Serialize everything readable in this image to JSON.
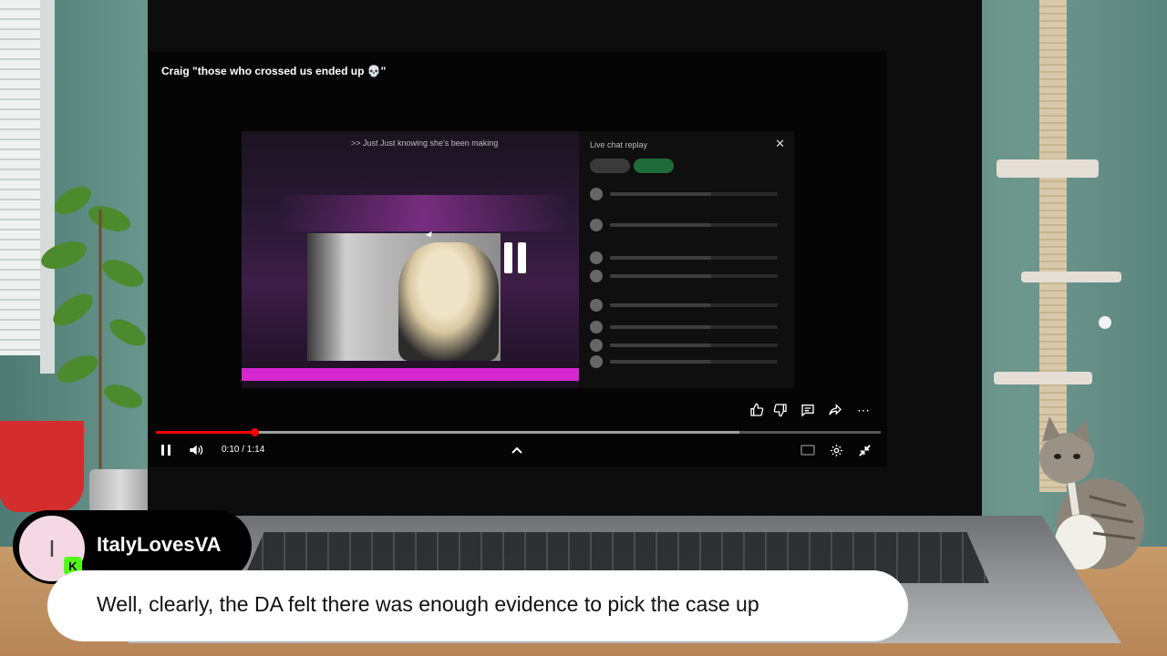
{
  "video": {
    "title": "Craig \"those who crossed us ended up 💀\"",
    "time_display": "0:10 / 1:14",
    "progress_fraction": 0.136,
    "buffered_fraction": 0.805,
    "inner_stream_caption": ">> Just Just knowing she's been making",
    "chat_header_label": "Live chat replay"
  },
  "actions": {
    "like_icon": "thumbs-up-icon",
    "dislike_icon": "thumbs-down-icon",
    "comment_icon": "comment-icon",
    "share_icon": "share-icon",
    "more_icon": "more-icon"
  },
  "overlay": {
    "avatar_letter": "I",
    "badge_letter": "K",
    "username": "ItalyLovesVA",
    "message": "Well, clearly, the DA felt there was enough evidence to pick the case up"
  },
  "colors": {
    "progress": "#ff0000",
    "badge": "#53fc18",
    "neon": "#d528d0"
  }
}
